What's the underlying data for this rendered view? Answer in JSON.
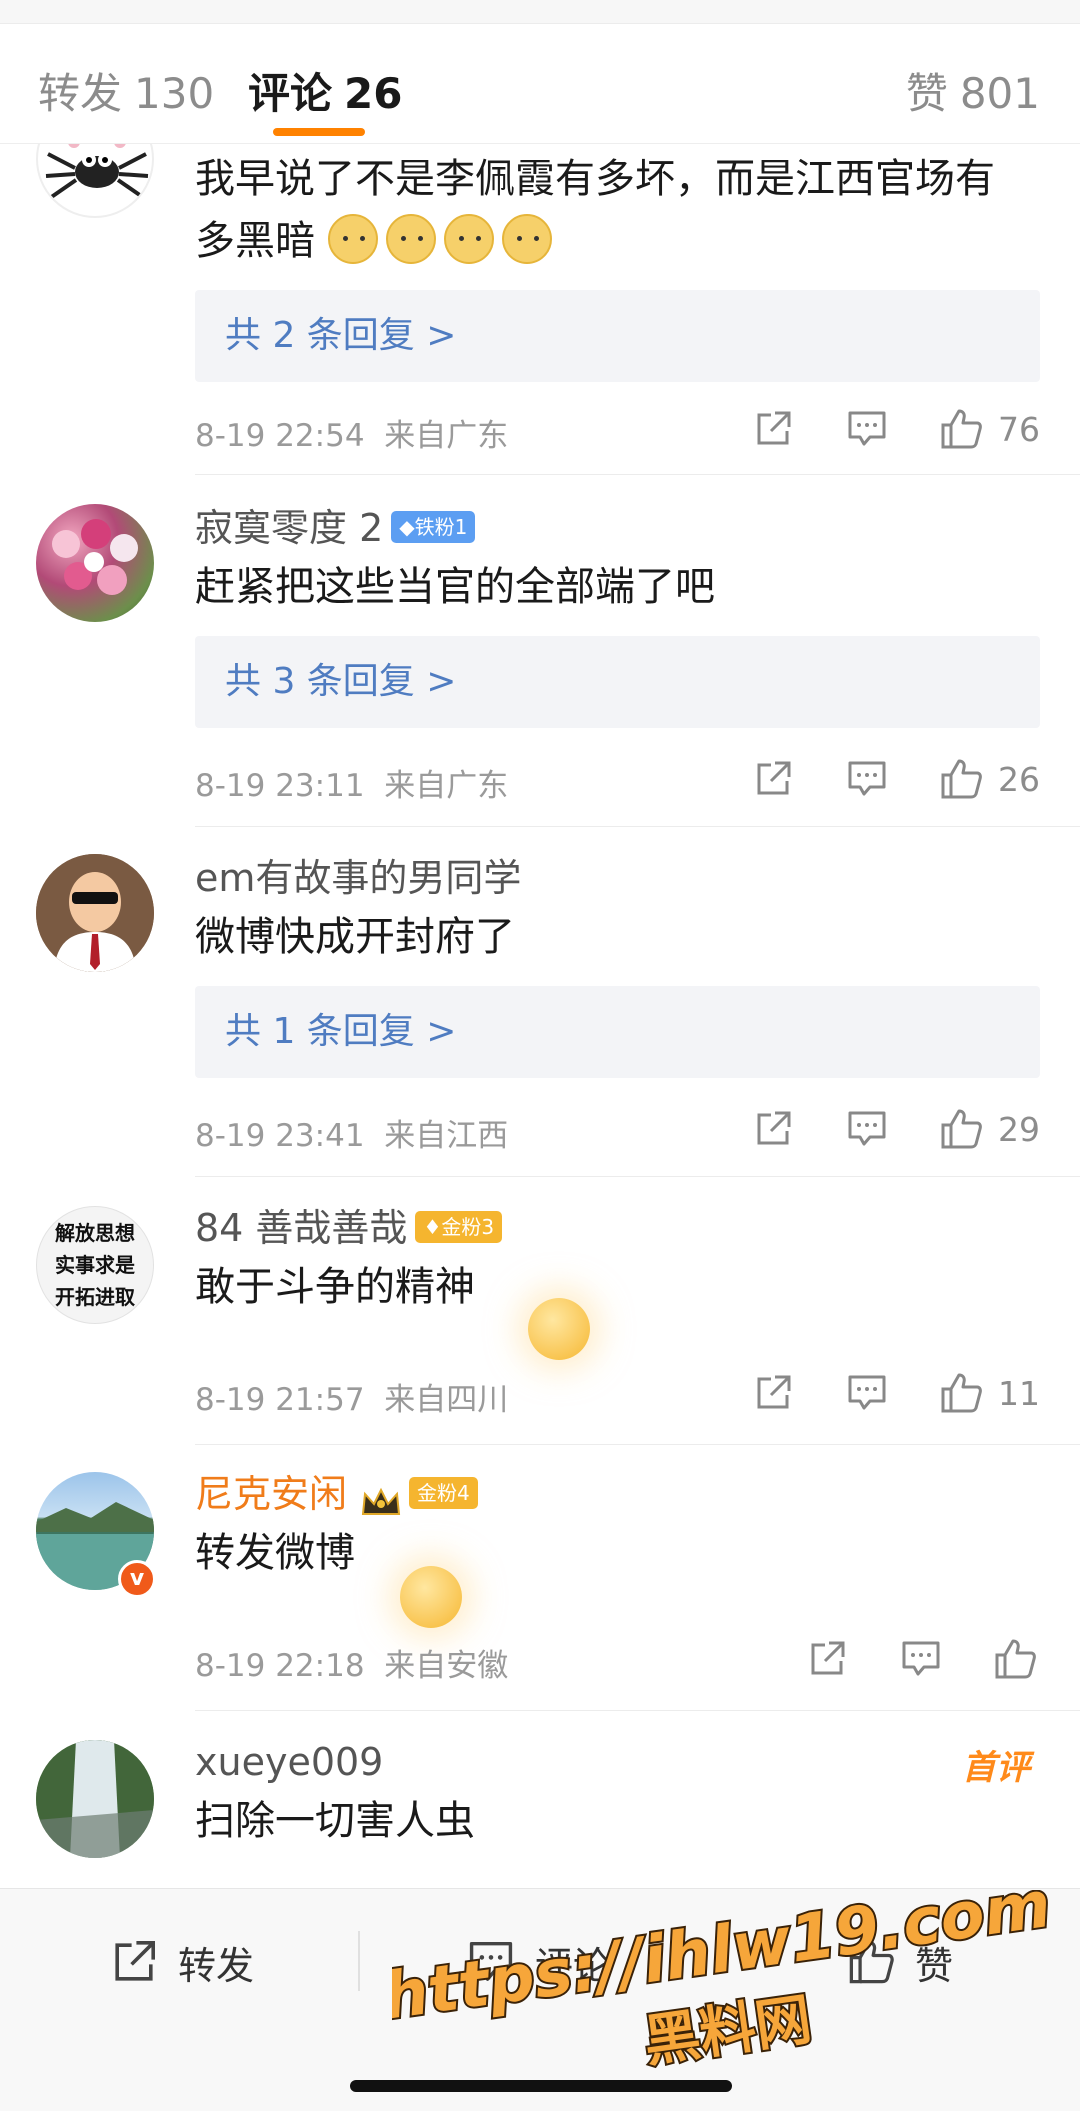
{
  "tabs": {
    "repost": {
      "label": "转发",
      "count": "130"
    },
    "comment": {
      "label": "评论",
      "count": "26"
    },
    "like": {
      "label": "赞",
      "count": "801"
    }
  },
  "comments": [
    {
      "text_line1": "我早说了不是李佩霞有多坏，而是江西官场有",
      "text_line2": "多黑暗",
      "reply_label": "共 2 条回复 >",
      "time": "8-19 22:54",
      "from": "来自广东",
      "likes": "76"
    },
    {
      "username": "寂寞零度 2",
      "badge": "铁粉1",
      "text": "赶紧把这些当官的全部端了吧",
      "reply_label": "共 3 条回复 >",
      "time": "8-19 23:11",
      "from": "来自广东",
      "likes": "26"
    },
    {
      "username": "em有故事的男同学",
      "text": "微博快成开封府了",
      "reply_label": "共 1 条回复 >",
      "time": "8-19 23:41",
      "from": "来自江西",
      "likes": "29"
    },
    {
      "username": "84 善哉善哉",
      "badge": "金粉3",
      "avatar_calligraphy": "解放思想\n实事求是\n开拓进取",
      "text": "敢于斗争的精神",
      "time": "8-19 21:57",
      "from": "来自四川",
      "likes": "11"
    },
    {
      "username": "尼克安闲",
      "badge": "金粉4",
      "text": "转发微博",
      "time": "8-19 22:18",
      "from": "来自安徽",
      "likes": ""
    },
    {
      "username": "xueye009",
      "tag": "首评",
      "text": "扫除一切害人虫"
    }
  ],
  "bottombar": {
    "repost_label": "转发",
    "comment_label": "评论",
    "like_label": "赞"
  },
  "watermark": {
    "url": "https://ihlw19.com",
    "name": "黑料网"
  },
  "colors": {
    "accent": "#ff8200",
    "reply_link": "#4f7cc1",
    "vip_name": "#f07c1a",
    "iron_badge": "#5c9ef2",
    "gold_badge": "#f5b52f"
  }
}
